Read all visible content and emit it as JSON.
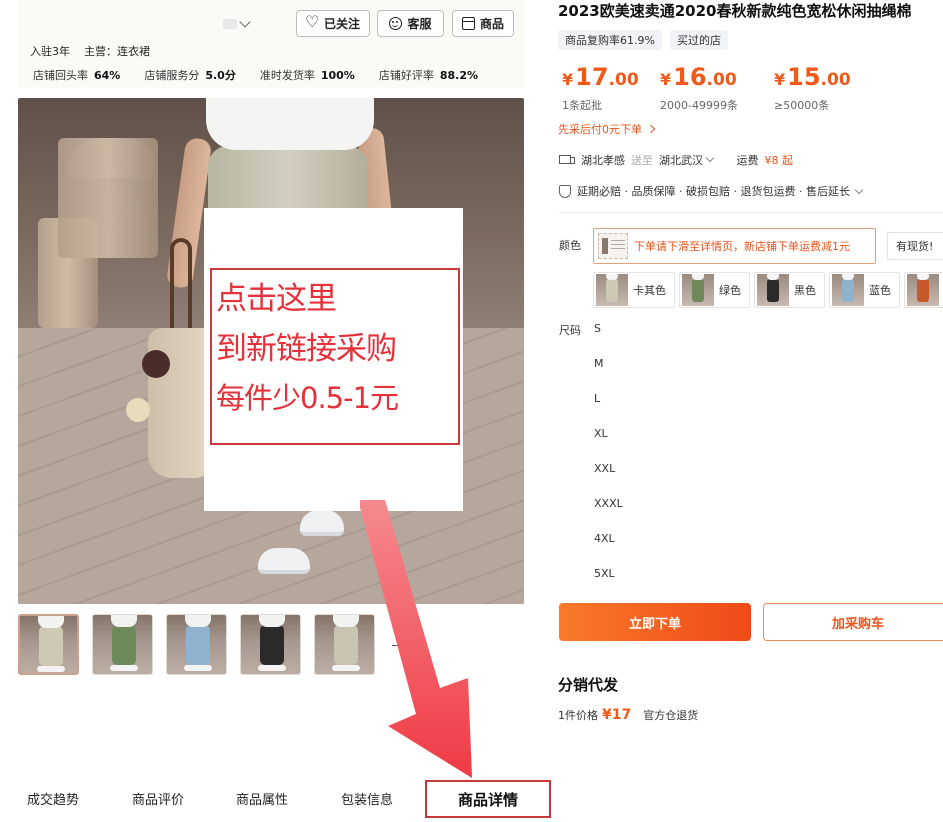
{
  "shop": {
    "follow_label": "已关注",
    "service_label": "客服",
    "products_label": "商品",
    "years": "入驻3年",
    "main_business": "主营：连衣裙",
    "stats": [
      {
        "label": "店铺回头率",
        "value": "64%"
      },
      {
        "label": "店铺服务分",
        "value": "5.0分"
      },
      {
        "label": "准时发货率",
        "value": "100%"
      },
      {
        "label": "店铺好评率",
        "value": "88.2%"
      }
    ]
  },
  "promo": {
    "lines": [
      "点击这里",
      "到新链接采购",
      "每件少0.5-1元"
    ],
    "color": "#e6313a",
    "border_color": "#c9383a"
  },
  "thumbnails": [
    {
      "pants_color": "#cfc8b4",
      "active": true
    },
    {
      "pants_color": "#6f8a5a",
      "active": false
    },
    {
      "pants_color": "#8fb2cf",
      "active": false
    },
    {
      "pants_color": "#2a2a2a",
      "active": false
    },
    {
      "pants_color": "#c9c3b2",
      "active": false
    }
  ],
  "bottom_tabs": [
    "成交趋势",
    "商品评价",
    "商品属性",
    "包装信息"
  ],
  "bottom_tab_active": "商品详情",
  "product": {
    "title": "2023欧美速卖通2020春秋新款纯色宽松休闲抽绳棉",
    "tags": [
      "商品复购率61.9%",
      "买过的店"
    ],
    "prices": [
      {
        "yen": "¥",
        "int": "17",
        "dec": ".00",
        "qty": "1条起批"
      },
      {
        "yen": "¥",
        "int": "16",
        "dec": ".00",
        "qty": "2000-49999条"
      },
      {
        "yen": "¥",
        "int": "15",
        "dec": ".00",
        "qty": "≥50000条"
      }
    ],
    "price_color": "#ef5a1a",
    "prepay": "先采后付0元下单",
    "shipping": {
      "from": "湖北孝感",
      "send_to": "送至",
      "to": "湖北武汉",
      "fee_label": "运费",
      "fee": "¥8 起"
    },
    "services": "延期必赔 · 品质保障 · 破损包赔 · 退货包运费 · 售后延长",
    "color_label": "颜色",
    "color_tip": "下单请下滑至详情页，新店铺下单运费减1元",
    "stock_label": "有现货!",
    "colors": [
      {
        "name": "卡其色",
        "pants_color": "#cfc8b4"
      },
      {
        "name": "绿色",
        "pants_color": "#6f8a5a"
      },
      {
        "name": "黑色",
        "pants_color": "#2a2a2a"
      },
      {
        "name": "蓝色",
        "pants_color": "#8fb2cf"
      },
      {
        "name": "",
        "pants_color": "#c65a2a"
      }
    ],
    "size_label": "尺码",
    "sizes": [
      "S",
      "M",
      "L",
      "XL",
      "XXL",
      "XXXL",
      "4XL",
      "5XL"
    ],
    "buy_label": "立即下单",
    "cart_label": "加采购车",
    "distribution": {
      "title": "分销代发",
      "price_label": "1件价格",
      "price": "¥17",
      "note": "官方仓退货"
    }
  }
}
